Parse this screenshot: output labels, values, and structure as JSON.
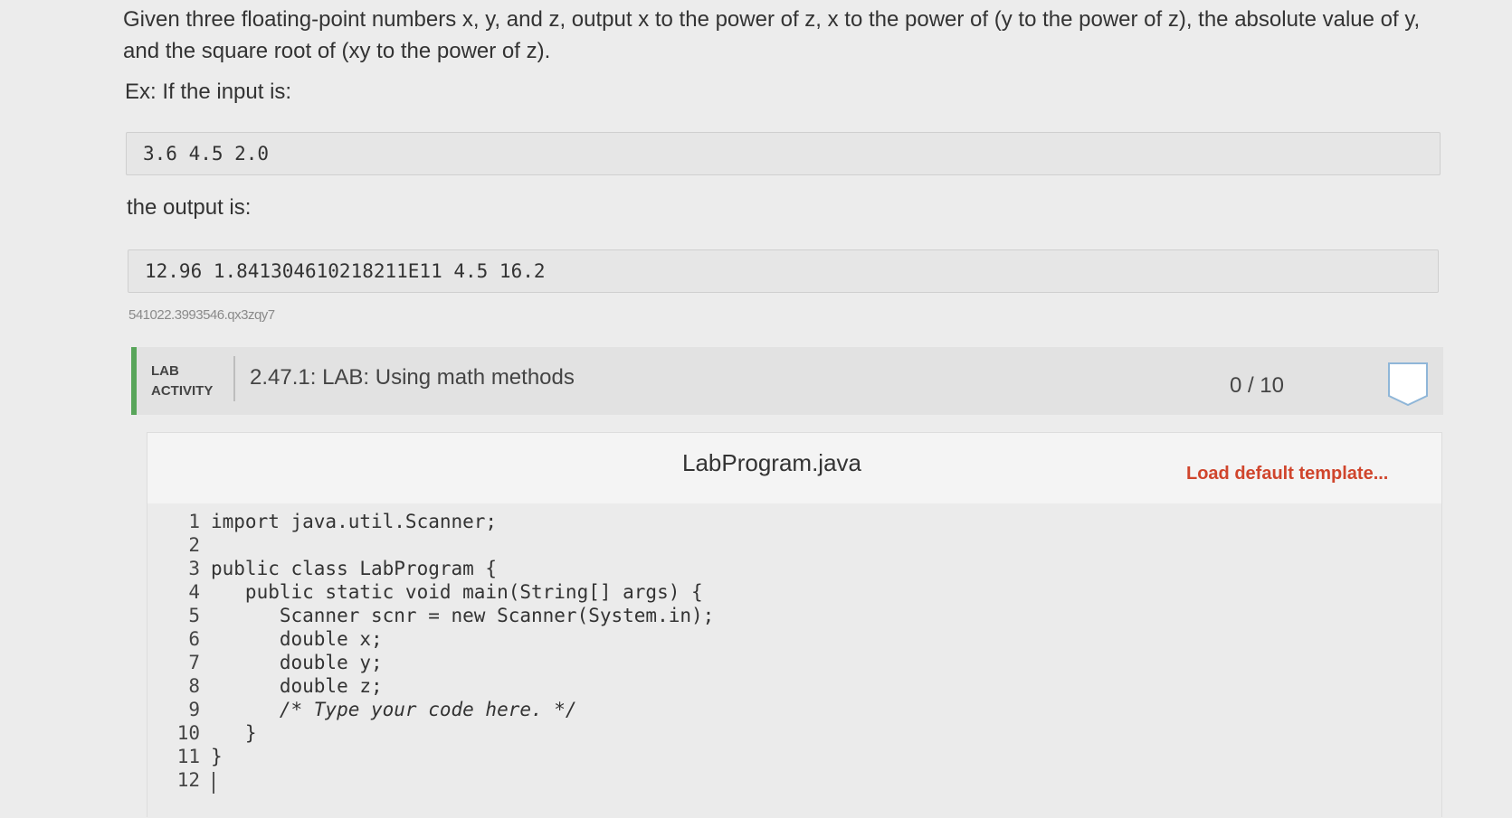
{
  "prompt": {
    "text": "Given three floating-point numbers x, y, and z, output x to the power of z, x to the power of (y to the power of z), the absolute value of y, and the square root of (xy to the power of z).",
    "example_label": "Ex: If the input is:",
    "example_input": "3.6 4.5 2.0",
    "output_label": "the output is:",
    "example_output": "12.96 1.841304610218211E11 4.5 16.2",
    "id_text": "541022.3993546.qx3zqy7"
  },
  "lab": {
    "tag_line1": "LAB",
    "tag_line2": "ACTIVITY",
    "title": "2.47.1: LAB: Using math methods",
    "score": "0 / 10",
    "score_badge_icon": "shield-badge-icon"
  },
  "editor": {
    "filename": "LabProgram.java",
    "load_template": "Load default template...",
    "lines": [
      {
        "n": "1",
        "code": "import java.util.Scanner;"
      },
      {
        "n": "2",
        "code": ""
      },
      {
        "n": "3",
        "code": "public class LabProgram {"
      },
      {
        "n": "4",
        "code": "   public static void main(String[] args) {"
      },
      {
        "n": "5",
        "code": "      Scanner scnr = new Scanner(System.in);"
      },
      {
        "n": "6",
        "code": "      double x;"
      },
      {
        "n": "7",
        "code": "      double y;"
      },
      {
        "n": "8",
        "code": "      double z;"
      },
      {
        "n": "9",
        "code": "      /* Type your code here. */"
      },
      {
        "n": "10",
        "code": "   }"
      },
      {
        "n": "11",
        "code": "}"
      },
      {
        "n": "12",
        "code": ""
      }
    ]
  },
  "colors": {
    "accent_green": "#58a55a",
    "link_red": "#d0452c"
  }
}
